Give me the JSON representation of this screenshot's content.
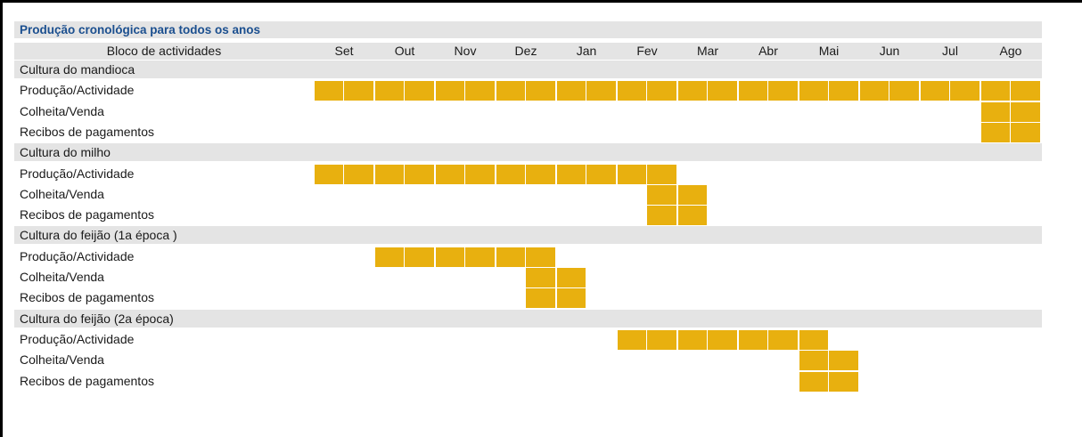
{
  "chart_data": {
    "type": "gantt",
    "title": "Produção cronológica para todos os anos",
    "label_column_header": "Bloco de actividades",
    "months": [
      "Set",
      "Out",
      "Nov",
      "Dez",
      "Jan",
      "Fev",
      "Mar",
      "Abr",
      "Mai",
      "Jun",
      "Jul",
      "Ago"
    ],
    "bar_color": "#e8b00f",
    "groups": [
      {
        "name": "Cultura do mandioca",
        "rows": [
          {
            "label": "Produção/Actividade",
            "periods": [
              1,
              2,
              3,
              4,
              5,
              6,
              7,
              8,
              9,
              10,
              11,
              12,
              13,
              14,
              15,
              16,
              17,
              18,
              19,
              20,
              21,
              22,
              23,
              24
            ]
          },
          {
            "label": "Colheita/Venda",
            "periods": [
              23,
              24
            ]
          },
          {
            "label": "Recibos de pagamentos",
            "periods": [
              23,
              24
            ]
          }
        ]
      },
      {
        "name": "Cultura do milho",
        "rows": [
          {
            "label": "Produção/Actividade",
            "periods": [
              1,
              2,
              3,
              4,
              5,
              6,
              7,
              8,
              9,
              10,
              11,
              12
            ]
          },
          {
            "label": "Colheita/Venda",
            "periods": [
              12,
              13
            ]
          },
          {
            "label": "Recibos de pagamentos",
            "periods": [
              12,
              13
            ]
          }
        ]
      },
      {
        "name": "Cultura do feijão (1a época )",
        "rows": [
          {
            "label": "Produção/Actividade",
            "periods": [
              3,
              4,
              5,
              6,
              7,
              8
            ]
          },
          {
            "label": "Colheita/Venda",
            "periods": [
              8,
              9
            ]
          },
          {
            "label": "Recibos de pagamentos",
            "periods": [
              8,
              9
            ]
          }
        ]
      },
      {
        "name": "Cultura do feijão (2a época)",
        "rows": [
          {
            "label": "Produção/Actividade",
            "periods": [
              11,
              12,
              13,
              14,
              15,
              16,
              17
            ]
          },
          {
            "label": "Colheita/Venda",
            "periods": [
              17,
              18
            ]
          },
          {
            "label": "Recibos de pagamentos",
            "periods": [
              17,
              18
            ]
          }
        ]
      }
    ]
  }
}
